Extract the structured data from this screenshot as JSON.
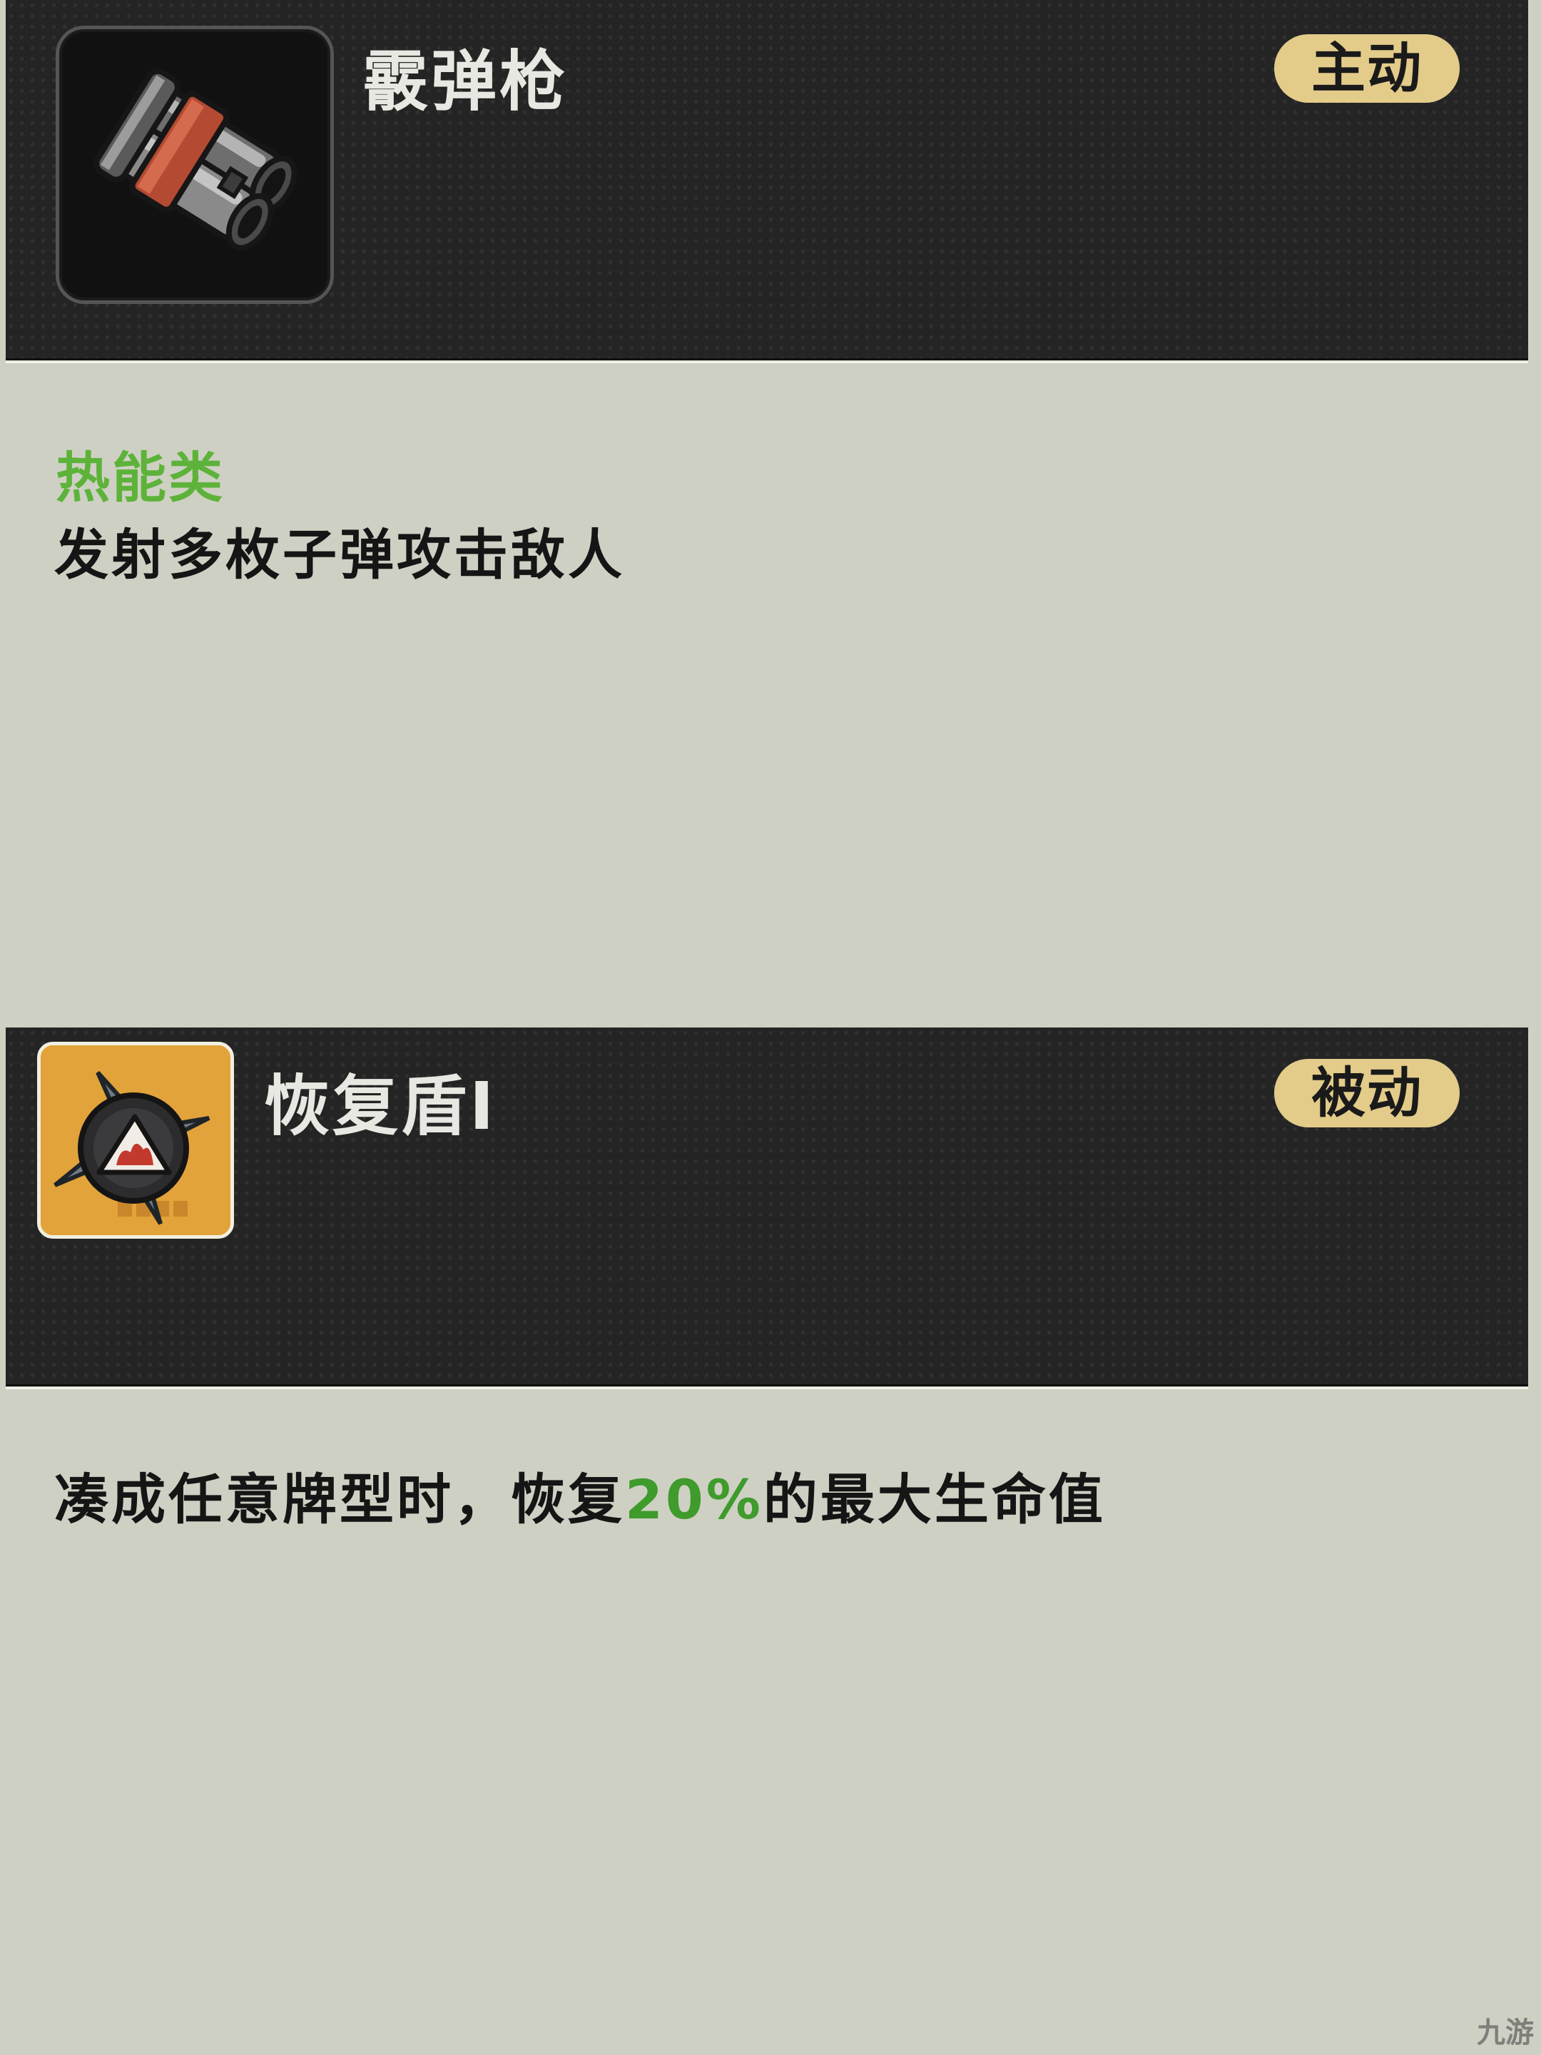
{
  "items": [
    {
      "name": "霰弹枪",
      "badge": "主动",
      "category": "热能类",
      "description": "发射多枚子弹攻击敌人",
      "icon": "shotgun-icon"
    },
    {
      "name": "恢复盾I",
      "badge": "被动",
      "description_before": "凑成任意牌型时，恢复",
      "description_highlight": "20%",
      "description_after": "的最大生命值",
      "icon": "spiked-shield-icon"
    }
  ],
  "colors": {
    "header_bg": "#242424",
    "body_bg": "#cfd0c4",
    "badge_bg": "#e3cb8a",
    "category_green": "#5db33a",
    "highlight_green": "#3f9b2c",
    "shield_icon_bg": "#e2a33a"
  },
  "watermark": "九游"
}
